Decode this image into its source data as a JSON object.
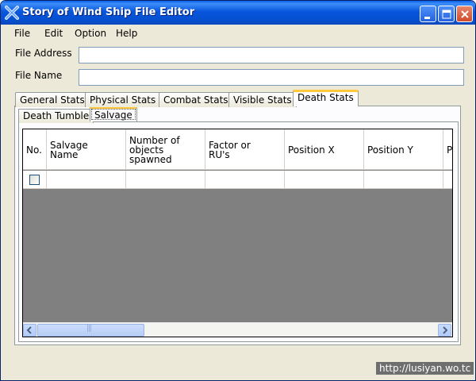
{
  "window": {
    "title": "Story of Wind Ship File Editor"
  },
  "menu": [
    "File",
    "Edit",
    "Option",
    "Help"
  ],
  "fields": {
    "address": {
      "label": "File Address",
      "value": ""
    },
    "name": {
      "label": "File Name",
      "value": ""
    }
  },
  "tabs": [
    "General Stats",
    "Physical Stats",
    "Combat Stats",
    "Visible Stats",
    "Death Stats"
  ],
  "active_tab": "Death Stats",
  "subtabs": [
    "Death Tumble",
    "Salvage"
  ],
  "active_subtab": "Salvage",
  "grid": {
    "columns": [
      "No.",
      "Salvage\nName",
      "Number of\nobjects\nspawned",
      "Factor or\nRU's",
      "Position X",
      "Position Y",
      "P"
    ],
    "rows": [
      {
        "checked": false,
        "cells": [
          "",
          "",
          "",
          "",
          "",
          ""
        ]
      }
    ]
  },
  "scrollbar": {
    "thumb_grip": "|||"
  },
  "watermark": "http://lusiyan.wo.tc",
  "colors": {
    "titlebar": "#0550d0",
    "active_tab_accent": "#ffc83c",
    "grid_background": "#808080"
  }
}
